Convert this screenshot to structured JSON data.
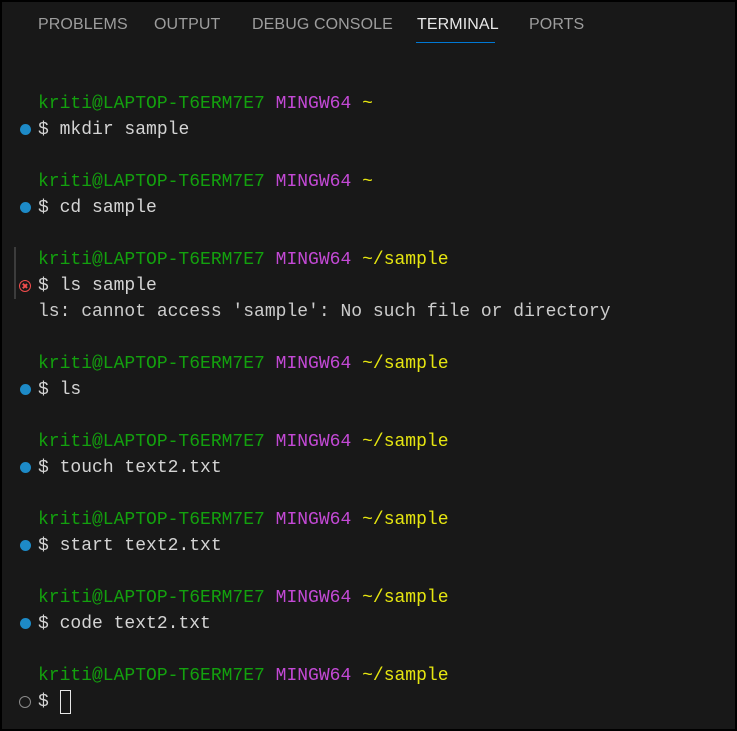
{
  "tabs": [
    {
      "label": "PROBLEMS",
      "active": false
    },
    {
      "label": "OUTPUT",
      "active": false
    },
    {
      "label": "DEBUG CONSOLE",
      "active": false
    },
    {
      "label": "TERMINAL",
      "active": true
    },
    {
      "label": "PORTS",
      "active": false
    }
  ],
  "colors": {
    "background": "#181818",
    "user": "#13a10e",
    "host": "#c349d5",
    "path": "#e5e510",
    "success_mark": "#1d8ac7",
    "error_mark": "#f14c4c",
    "tab_underline": "#0078d4"
  },
  "prompt": {
    "user_host": "kriti@LAPTOP-T6ERM7E7",
    "shell": "MINGW64",
    "dollar": "$"
  },
  "blocks": [
    {
      "path": "~",
      "command": "mkdir sample",
      "status": "success",
      "output": ""
    },
    {
      "path": "~",
      "command": "cd sample",
      "status": "success",
      "output": ""
    },
    {
      "path": "~/sample",
      "command": "ls sample",
      "status": "error",
      "output": "ls: cannot access 'sample': No such file or directory"
    },
    {
      "path": "~/sample",
      "command": "ls",
      "status": "success",
      "output": ""
    },
    {
      "path": "~/sample",
      "command": "touch text2.txt",
      "status": "success",
      "output": ""
    },
    {
      "path": "~/sample",
      "command": "start text2.txt",
      "status": "success",
      "output": ""
    },
    {
      "path": "~/sample",
      "command": "code text2.txt",
      "status": "success",
      "output": ""
    },
    {
      "path": "~/sample",
      "command": "",
      "status": "idle",
      "output": ""
    }
  ]
}
